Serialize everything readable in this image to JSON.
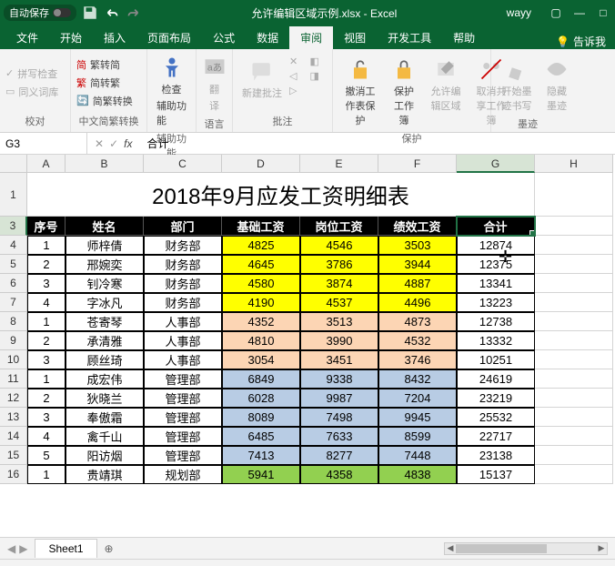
{
  "titlebar": {
    "auto_save": "自动保存",
    "filename": "允许编辑区域示例.xlsx - Excel",
    "user": "wayy"
  },
  "tabs": {
    "file": "文件",
    "home": "开始",
    "insert": "插入",
    "layout": "页面布局",
    "formulas": "公式",
    "data": "数据",
    "review": "审阅",
    "view": "视图",
    "dev": "开发工具",
    "help": "帮助",
    "tell_me": "告诉我"
  },
  "ribbon": {
    "proofing": {
      "spell": "拼写检查",
      "thesaurus": "同义词库",
      "label": "校对"
    },
    "chinese": {
      "t2s": "繁转简",
      "s2t": "简转繁",
      "convert": "简繁转换",
      "label": "中文简繁转换"
    },
    "accessibility": {
      "check": "检查",
      "a11y": "辅助功能",
      "label": "辅助功能"
    },
    "language": {
      "translate": "翻",
      "lang": "译",
      "label": "语言"
    },
    "comments": {
      "new": "新建批注",
      "label": "批注"
    },
    "protect": {
      "unprotect": "撤消工作表保护",
      "workbook": "保护工作簿",
      "allow_edit": "允许编辑区域",
      "unshare": "取消共享工作簿",
      "label": "保护"
    },
    "ink": {
      "start": "开始墨迹书写",
      "hide": "隐藏墨迹",
      "label": "墨迹"
    }
  },
  "formula_bar": {
    "name": "G3",
    "value": "合计"
  },
  "columns": [
    "A",
    "B",
    "C",
    "D",
    "E",
    "F",
    "G",
    "H"
  ],
  "row_numbers": [
    1,
    3,
    4,
    5,
    6,
    7,
    8,
    9,
    10,
    11,
    12,
    13,
    14,
    15,
    16
  ],
  "sheet": {
    "title": "2018年9月应发工资明细表",
    "headers": [
      "序号",
      "姓名",
      "部门",
      "基础工资",
      "岗位工资",
      "绩效工资",
      "合计"
    ],
    "rows": [
      {
        "no": "1",
        "name": "师梓倩",
        "dept": "财务部",
        "base": "4825",
        "post": "4546",
        "perf": "3503",
        "total": "12874",
        "cls": "yellow"
      },
      {
        "no": "2",
        "name": "邢婉奕",
        "dept": "财务部",
        "base": "4645",
        "post": "3786",
        "perf": "3944",
        "total": "12375",
        "cls": "yellow"
      },
      {
        "no": "3",
        "name": "钊冷寒",
        "dept": "财务部",
        "base": "4580",
        "post": "3874",
        "perf": "4887",
        "total": "13341",
        "cls": "yellow"
      },
      {
        "no": "4",
        "name": "字冰凡",
        "dept": "财务部",
        "base": "4190",
        "post": "4537",
        "perf": "4496",
        "total": "13223",
        "cls": "yellow"
      },
      {
        "no": "1",
        "name": "苍寄琴",
        "dept": "人事部",
        "base": "4352",
        "post": "3513",
        "perf": "4873",
        "total": "12738",
        "cls": "orange"
      },
      {
        "no": "2",
        "name": "承清雅",
        "dept": "人事部",
        "base": "4810",
        "post": "3990",
        "perf": "4532",
        "total": "13332",
        "cls": "orange"
      },
      {
        "no": "3",
        "name": "顾丝琦",
        "dept": "人事部",
        "base": "3054",
        "post": "3451",
        "perf": "3746",
        "total": "10251",
        "cls": "orange"
      },
      {
        "no": "1",
        "name": "成宏伟",
        "dept": "管理部",
        "base": "6849",
        "post": "9338",
        "perf": "8432",
        "total": "24619",
        "cls": "blue"
      },
      {
        "no": "2",
        "name": "狄晓兰",
        "dept": "管理部",
        "base": "6028",
        "post": "9987",
        "perf": "7204",
        "total": "23219",
        "cls": "blue"
      },
      {
        "no": "3",
        "name": "奉傲霜",
        "dept": "管理部",
        "base": "8089",
        "post": "7498",
        "perf": "9945",
        "total": "25532",
        "cls": "blue"
      },
      {
        "no": "4",
        "name": "禽千山",
        "dept": "管理部",
        "base": "6485",
        "post": "7633",
        "perf": "8599",
        "total": "22717",
        "cls": "blue"
      },
      {
        "no": "5",
        "name": "阳访烟",
        "dept": "管理部",
        "base": "7413",
        "post": "8277",
        "perf": "7448",
        "total": "23138",
        "cls": "blue"
      },
      {
        "no": "1",
        "name": "贵靖琪",
        "dept": "规划部",
        "base": "5941",
        "post": "4358",
        "perf": "4838",
        "total": "15137",
        "cls": "green"
      }
    ]
  },
  "sheet_tab": "Sheet1"
}
